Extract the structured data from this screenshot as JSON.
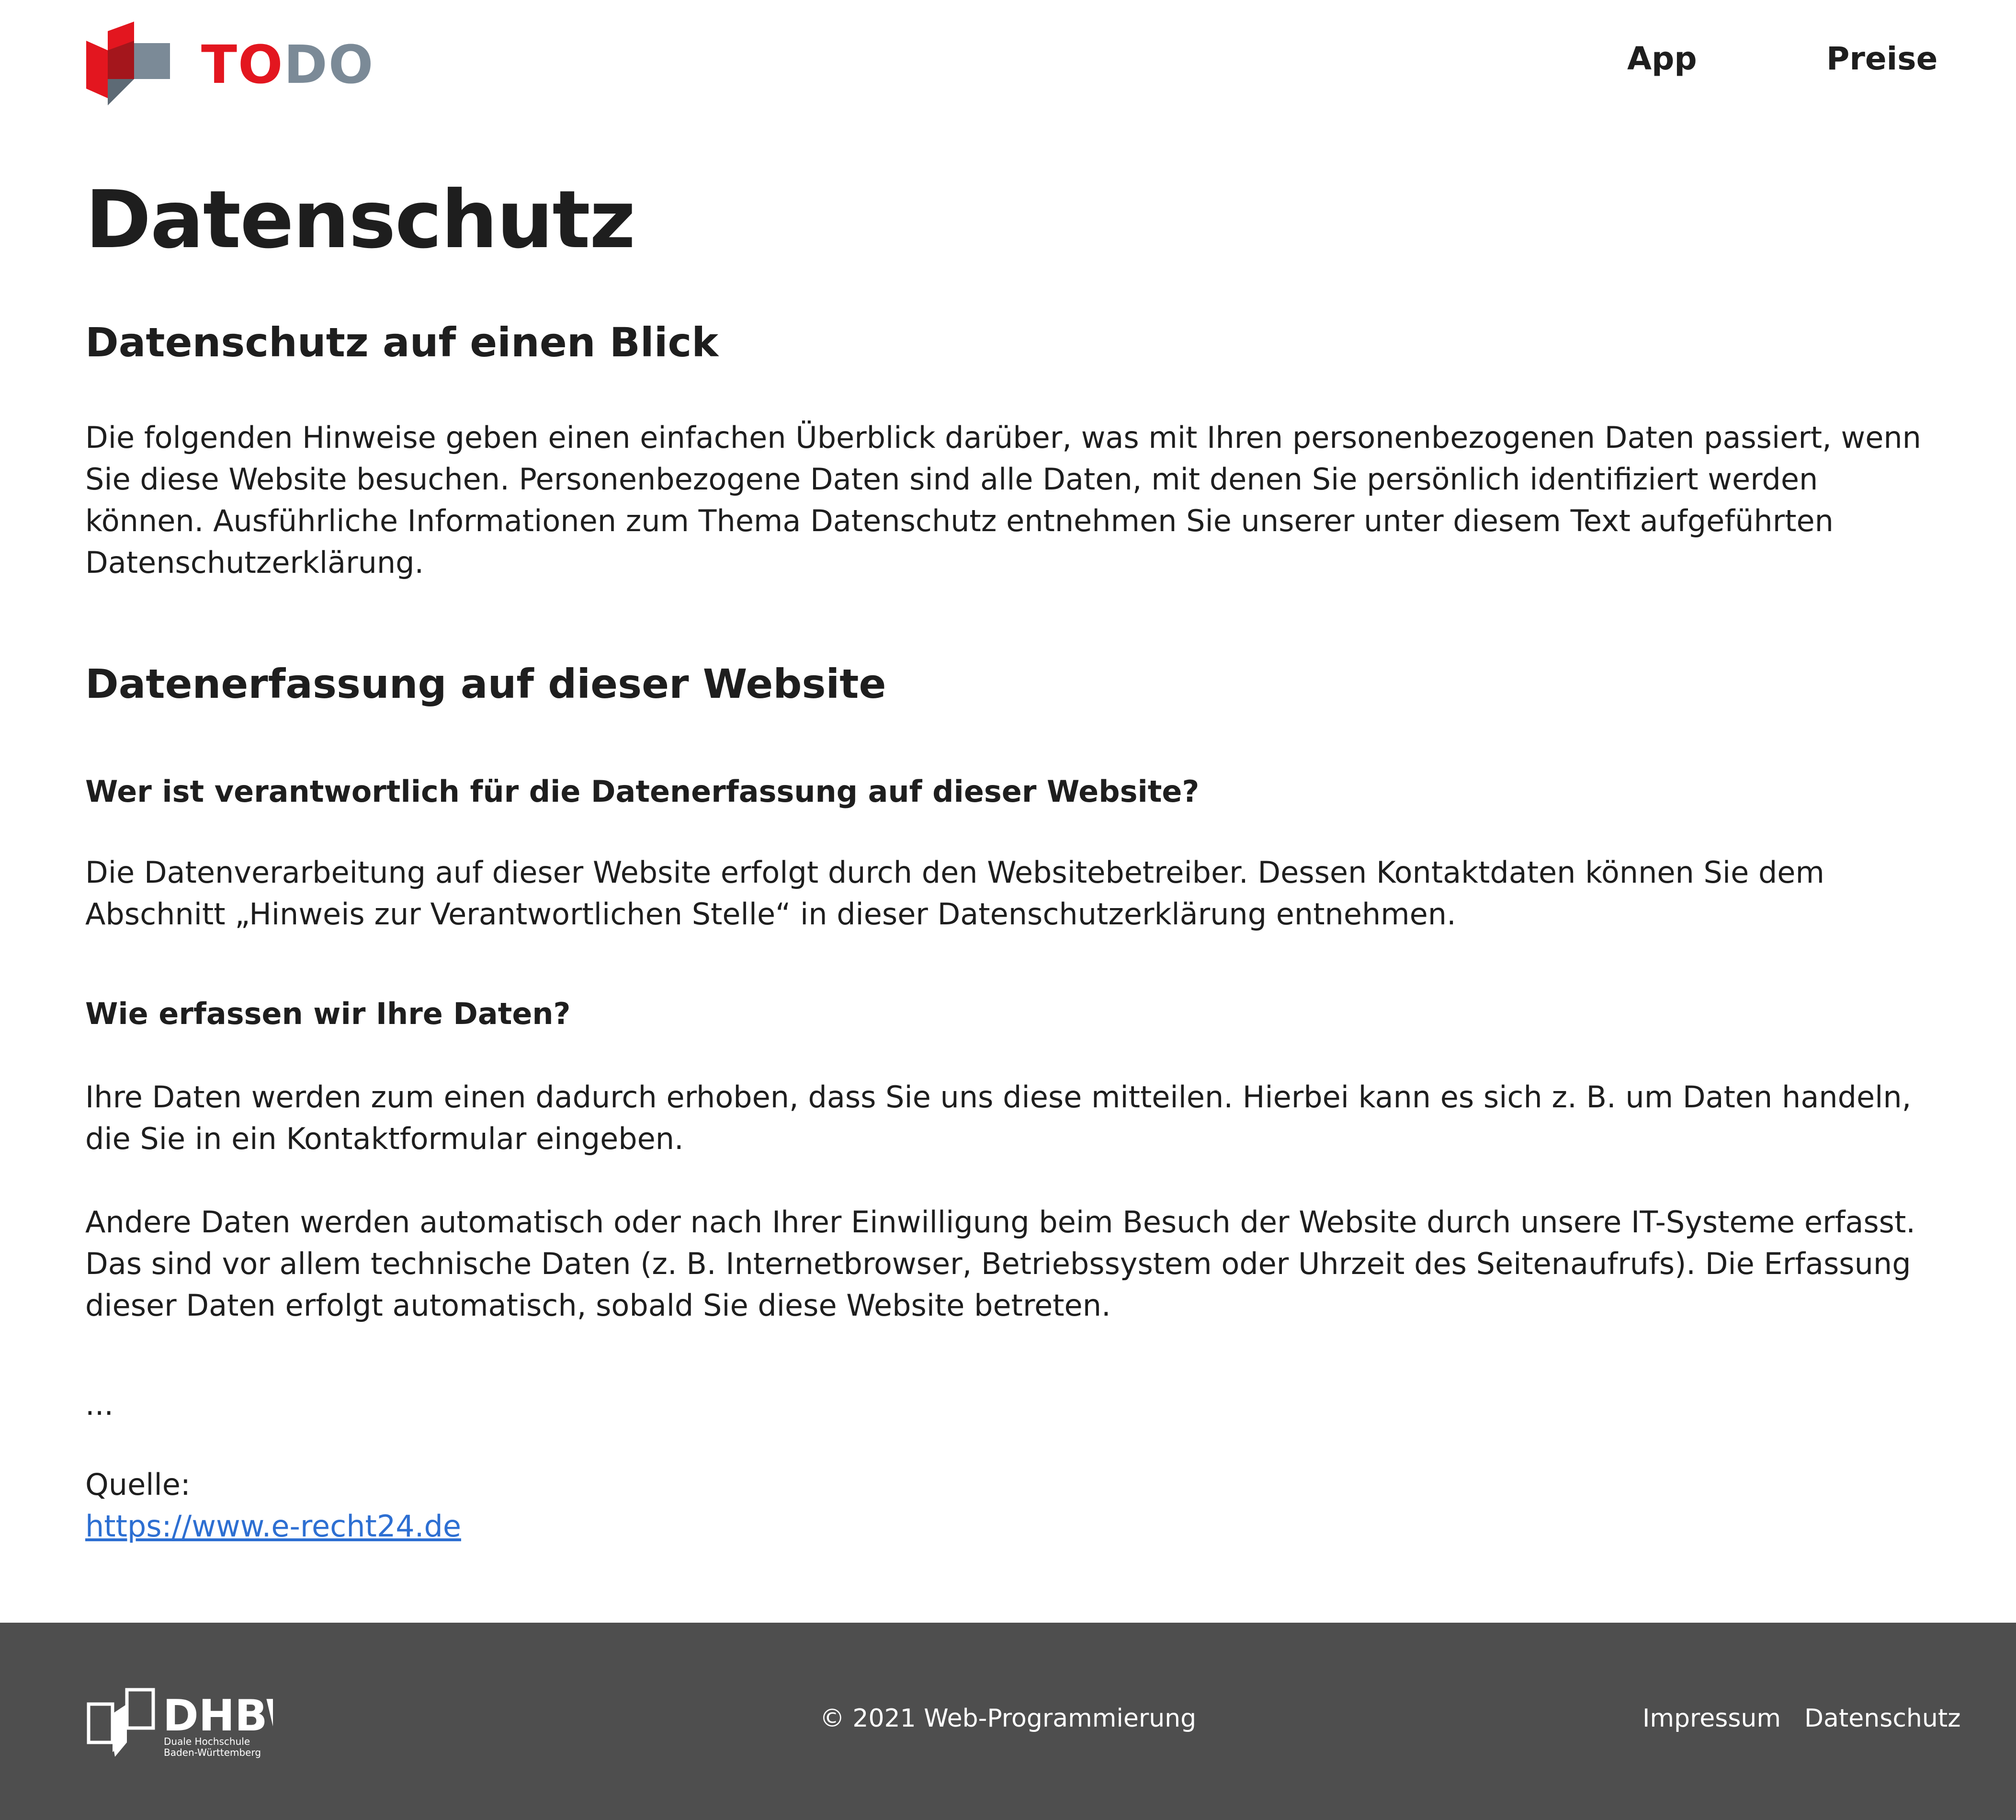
{
  "header": {
    "logo_part1": "TO",
    "logo_part2": "DO",
    "nav": {
      "app": "App",
      "preise": "Preise"
    }
  },
  "main": {
    "title": "Datenschutz",
    "section1_heading": "Datenschutz auf einen Blick",
    "section1_text": "Die folgenden Hinweise geben einen einfachen Überblick darüber, was mit Ihren personenbezogenen Daten passiert, wenn Sie diese Website besuchen. Personenbezogene Daten sind alle Daten, mit denen Sie persönlich identifiziert werden können. Ausführliche Informationen zum Thema Datenschutz entnehmen Sie unserer unter diesem Text aufgeführten Datenschutzerklärung.",
    "section2_heading": "Datenerfassung auf dieser Website",
    "q1_heading": "Wer ist verantwortlich für die Datenerfassung auf dieser Website?",
    "q1_text": "Die Datenverarbeitung auf dieser Website erfolgt durch den Websitebetreiber. Dessen Kontaktdaten können Sie dem Abschnitt „Hinweis zur Verantwortlichen Stelle“ in dieser Datenschutzerklärung entnehmen.",
    "q2_heading": "Wie erfassen wir Ihre Daten?",
    "q2_text1": "Ihre Daten werden zum einen dadurch erhoben, dass Sie uns diese mitteilen. Hierbei kann es sich z. B. um Daten handeln, die Sie in ein Kontaktformular eingeben.",
    "q2_text2": "Andere Daten werden automatisch oder nach Ihrer Einwilligung beim Besuch der Website durch unsere IT-Systeme erfasst. Das sind vor allem technische Daten (z. B. Internetbrowser, Betriebssystem oder Uhrzeit des Seitenaufrufs). Die Erfassung dieser Daten erfolgt automatisch, sobald Sie diese Website betreten.",
    "ellipsis": "...",
    "source_label": "Quelle:",
    "source_link": "https://www.e-recht24.de"
  },
  "footer": {
    "dhbw_name": "DHBW",
    "dhbw_line1": "Duale Hochschule",
    "dhbw_line2": "Baden-Württemberg",
    "copyright": "© 2021 Web-Programmierung",
    "impressum": "Impressum",
    "datenschutz": "Datenschutz"
  },
  "colors": {
    "brand_red": "#e3161f",
    "brand_gray": "#7b8a97",
    "link_blue": "#2d6fd2",
    "footer_bg": "#4e4e4e"
  },
  "icons": {
    "logo": "todo-logo-icon",
    "footer_logo": "dhbw-logo-icon"
  }
}
